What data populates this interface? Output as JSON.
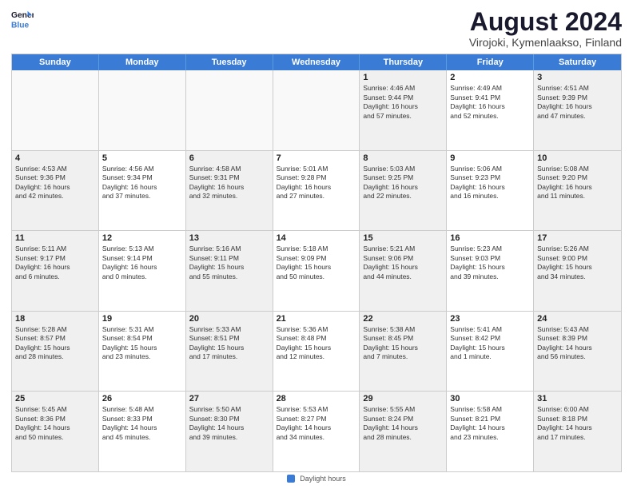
{
  "logo": {
    "line1": "General",
    "line2": "Blue"
  },
  "title": "August 2024",
  "subtitle": "Virojoki, Kymenlaakso, Finland",
  "weekdays": [
    "Sunday",
    "Monday",
    "Tuesday",
    "Wednesday",
    "Thursday",
    "Friday",
    "Saturday"
  ],
  "footer": {
    "dot_label": "Daylight hours"
  },
  "rows": [
    [
      {
        "day": "",
        "info": ""
      },
      {
        "day": "",
        "info": ""
      },
      {
        "day": "",
        "info": ""
      },
      {
        "day": "",
        "info": ""
      },
      {
        "day": "1",
        "info": "Sunrise: 4:46 AM\nSunset: 9:44 PM\nDaylight: 16 hours\nand 57 minutes."
      },
      {
        "day": "2",
        "info": "Sunrise: 4:49 AM\nSunset: 9:41 PM\nDaylight: 16 hours\nand 52 minutes."
      },
      {
        "day": "3",
        "info": "Sunrise: 4:51 AM\nSunset: 9:39 PM\nDaylight: 16 hours\nand 47 minutes."
      }
    ],
    [
      {
        "day": "4",
        "info": "Sunrise: 4:53 AM\nSunset: 9:36 PM\nDaylight: 16 hours\nand 42 minutes."
      },
      {
        "day": "5",
        "info": "Sunrise: 4:56 AM\nSunset: 9:34 PM\nDaylight: 16 hours\nand 37 minutes."
      },
      {
        "day": "6",
        "info": "Sunrise: 4:58 AM\nSunset: 9:31 PM\nDaylight: 16 hours\nand 32 minutes."
      },
      {
        "day": "7",
        "info": "Sunrise: 5:01 AM\nSunset: 9:28 PM\nDaylight: 16 hours\nand 27 minutes."
      },
      {
        "day": "8",
        "info": "Sunrise: 5:03 AM\nSunset: 9:25 PM\nDaylight: 16 hours\nand 22 minutes."
      },
      {
        "day": "9",
        "info": "Sunrise: 5:06 AM\nSunset: 9:23 PM\nDaylight: 16 hours\nand 16 minutes."
      },
      {
        "day": "10",
        "info": "Sunrise: 5:08 AM\nSunset: 9:20 PM\nDaylight: 16 hours\nand 11 minutes."
      }
    ],
    [
      {
        "day": "11",
        "info": "Sunrise: 5:11 AM\nSunset: 9:17 PM\nDaylight: 16 hours\nand 6 minutes."
      },
      {
        "day": "12",
        "info": "Sunrise: 5:13 AM\nSunset: 9:14 PM\nDaylight: 16 hours\nand 0 minutes."
      },
      {
        "day": "13",
        "info": "Sunrise: 5:16 AM\nSunset: 9:11 PM\nDaylight: 15 hours\nand 55 minutes."
      },
      {
        "day": "14",
        "info": "Sunrise: 5:18 AM\nSunset: 9:09 PM\nDaylight: 15 hours\nand 50 minutes."
      },
      {
        "day": "15",
        "info": "Sunrise: 5:21 AM\nSunset: 9:06 PM\nDaylight: 15 hours\nand 44 minutes."
      },
      {
        "day": "16",
        "info": "Sunrise: 5:23 AM\nSunset: 9:03 PM\nDaylight: 15 hours\nand 39 minutes."
      },
      {
        "day": "17",
        "info": "Sunrise: 5:26 AM\nSunset: 9:00 PM\nDaylight: 15 hours\nand 34 minutes."
      }
    ],
    [
      {
        "day": "18",
        "info": "Sunrise: 5:28 AM\nSunset: 8:57 PM\nDaylight: 15 hours\nand 28 minutes."
      },
      {
        "day": "19",
        "info": "Sunrise: 5:31 AM\nSunset: 8:54 PM\nDaylight: 15 hours\nand 23 minutes."
      },
      {
        "day": "20",
        "info": "Sunrise: 5:33 AM\nSunset: 8:51 PM\nDaylight: 15 hours\nand 17 minutes."
      },
      {
        "day": "21",
        "info": "Sunrise: 5:36 AM\nSunset: 8:48 PM\nDaylight: 15 hours\nand 12 minutes."
      },
      {
        "day": "22",
        "info": "Sunrise: 5:38 AM\nSunset: 8:45 PM\nDaylight: 15 hours\nand 7 minutes."
      },
      {
        "day": "23",
        "info": "Sunrise: 5:41 AM\nSunset: 8:42 PM\nDaylight: 15 hours\nand 1 minute."
      },
      {
        "day": "24",
        "info": "Sunrise: 5:43 AM\nSunset: 8:39 PM\nDaylight: 14 hours\nand 56 minutes."
      }
    ],
    [
      {
        "day": "25",
        "info": "Sunrise: 5:45 AM\nSunset: 8:36 PM\nDaylight: 14 hours\nand 50 minutes."
      },
      {
        "day": "26",
        "info": "Sunrise: 5:48 AM\nSunset: 8:33 PM\nDaylight: 14 hours\nand 45 minutes."
      },
      {
        "day": "27",
        "info": "Sunrise: 5:50 AM\nSunset: 8:30 PM\nDaylight: 14 hours\nand 39 minutes."
      },
      {
        "day": "28",
        "info": "Sunrise: 5:53 AM\nSunset: 8:27 PM\nDaylight: 14 hours\nand 34 minutes."
      },
      {
        "day": "29",
        "info": "Sunrise: 5:55 AM\nSunset: 8:24 PM\nDaylight: 14 hours\nand 28 minutes."
      },
      {
        "day": "30",
        "info": "Sunrise: 5:58 AM\nSunset: 8:21 PM\nDaylight: 14 hours\nand 23 minutes."
      },
      {
        "day": "31",
        "info": "Sunrise: 6:00 AM\nSunset: 8:18 PM\nDaylight: 14 hours\nand 17 minutes."
      }
    ]
  ]
}
